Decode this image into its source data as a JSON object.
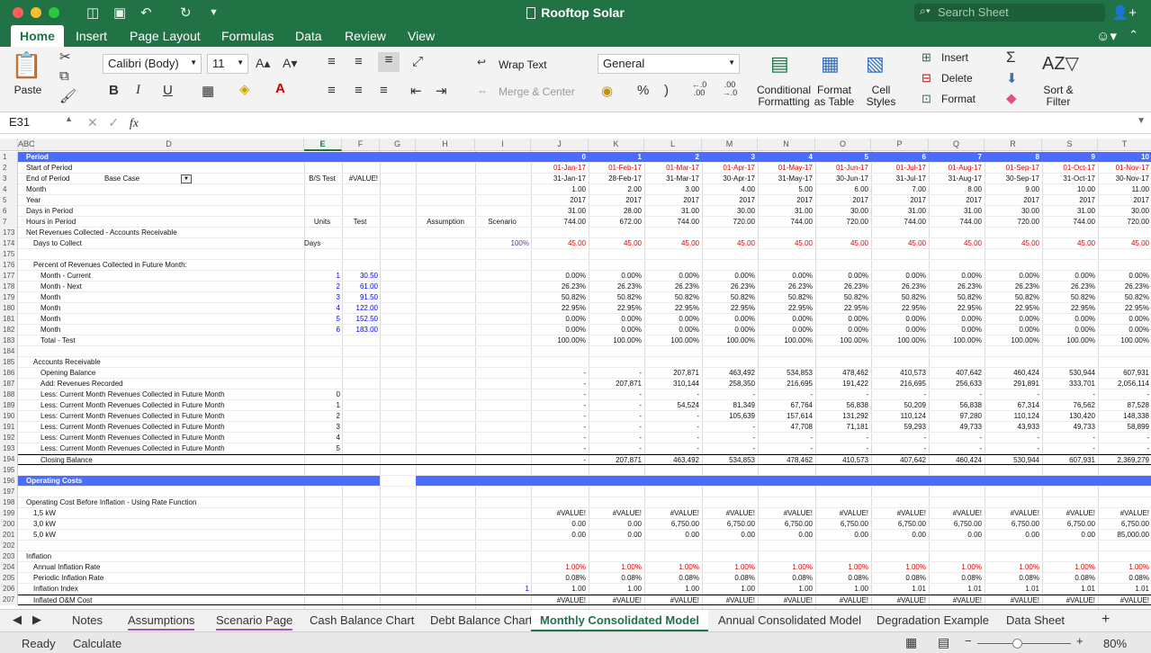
{
  "window": {
    "title": "Rooftop Solar",
    "search_placeholder": "Search Sheet"
  },
  "ribbon_tabs": [
    "Home",
    "Insert",
    "Page Layout",
    "Formulas",
    "Data",
    "Review",
    "View"
  ],
  "ribbon": {
    "paste": "Paste",
    "font_name": "Calibri (Body)",
    "font_size": "11",
    "wrap_text": "Wrap Text",
    "merge_center": "Merge & Center",
    "number_format": "General",
    "conditional_formatting": [
      "Conditional",
      "Formatting"
    ],
    "format_as_table": [
      "Format",
      "as Table"
    ],
    "cell_styles": [
      "Cell",
      "Styles"
    ],
    "insert": "Insert",
    "delete": "Delete",
    "format": "Format",
    "sort_filter": [
      "Sort &",
      "Filter"
    ],
    "bold": "B",
    "italic": "I",
    "underline": "U",
    "percent": "%",
    "comma": ")",
    "inc_dec": ".0\n.00",
    "dec_dec": ".00\n.0"
  },
  "formula_bar": {
    "name_box": "E31",
    "fx": "fx",
    "formula": ""
  },
  "columns": [
    "A",
    "B",
    "C",
    "D",
    "E",
    "F",
    "G",
    "H",
    "I",
    "J",
    "K",
    "L",
    "M",
    "N",
    "O",
    "P",
    "Q",
    "R",
    "S",
    "T"
  ],
  "selected_column": "E",
  "rows": [
    {
      "n": "1",
      "band": true,
      "label": "Period",
      "j": "0",
      "k": "1",
      "l": "2",
      "m": "3",
      "nn": "4",
      "o": "5",
      "p": "6",
      "q": "7",
      "r": "8",
      "s": "9",
      "t": "10"
    },
    {
      "n": "2",
      "label": "Start of Period",
      "red": true,
      "j": "01-Jan-17",
      "k": "01-Feb-17",
      "l": "01-Mar-17",
      "m": "01-Apr-17",
      "nn": "01-May-17",
      "o": "01-Jun-17",
      "p": "01-Jul-17",
      "q": "01-Aug-17",
      "r": "01-Sep-17",
      "s": "01-Oct-17",
      "t": "01-Nov-17"
    },
    {
      "n": "3",
      "label": "End of Period",
      "d2": "Base Case",
      "e": "B/S Test",
      "f": "#VALUE!",
      "j": "31-Jan-17",
      "k": "28-Feb-17",
      "l": "31-Mar-17",
      "m": "30-Apr-17",
      "nn": "31-May-17",
      "o": "30-Jun-17",
      "p": "31-Jul-17",
      "q": "31-Aug-17",
      "r": "30-Sep-17",
      "s": "31-Oct-17",
      "t": "30-Nov-17"
    },
    {
      "n": "4",
      "label": "Month",
      "j": "1.00",
      "k": "2.00",
      "l": "3.00",
      "m": "4.00",
      "nn": "5.00",
      "o": "6.00",
      "p": "7.00",
      "q": "8.00",
      "r": "9.00",
      "s": "10.00",
      "t": "11.00"
    },
    {
      "n": "5",
      "label": "Year",
      "j": "2017",
      "k": "2017",
      "l": "2017",
      "m": "2017",
      "nn": "2017",
      "o": "2017",
      "p": "2017",
      "q": "2017",
      "r": "2017",
      "s": "2017",
      "t": "2017"
    },
    {
      "n": "6",
      "label": "Days in Period",
      "j": "31.00",
      "k": "28.00",
      "l": "31.00",
      "m": "30.00",
      "nn": "31.00",
      "o": "30.00",
      "p": "31.00",
      "q": "31.00",
      "r": "30.00",
      "s": "31.00",
      "t": "30.00"
    },
    {
      "n": "7",
      "label": "Hours in Period",
      "e": "Units",
      "f": "Test",
      "h": "Assumption",
      "i": "Scenario",
      "j": "744.00",
      "k": "672.00",
      "l": "744.00",
      "m": "720.00",
      "nn": "744.00",
      "o": "720.00",
      "p": "744.00",
      "q": "744.00",
      "r": "720.00",
      "s": "744.00",
      "t": "720.00"
    },
    {
      "n": "173",
      "label": "Net Revenues Collected - Accounts Receivable"
    },
    {
      "n": "174",
      "label": "Days to Collect",
      "ind": 1,
      "e": "Days",
      "i": "100%",
      "ipurple": true,
      "red": true,
      "j": "45.00",
      "k": "45.00",
      "l": "45.00",
      "m": "45.00",
      "nn": "45.00",
      "o": "45.00",
      "p": "45.00",
      "q": "45.00",
      "r": "45.00",
      "s": "45.00",
      "t": "45.00"
    },
    {
      "n": "175"
    },
    {
      "n": "176",
      "label": "Percent of Revenues Collected in Future Month:",
      "ind": 1
    },
    {
      "n": "177",
      "label": "Month - Current",
      "ind": 2,
      "e": "1",
      "f": "30.50",
      "blue": true,
      "j": "0.00%",
      "k": "0.00%",
      "l": "0.00%",
      "m": "0.00%",
      "nn": "0.00%",
      "o": "0.00%",
      "p": "0.00%",
      "q": "0.00%",
      "r": "0.00%",
      "s": "0.00%",
      "t": "0.00%"
    },
    {
      "n": "178",
      "label": "Month - Next",
      "ind": 2,
      "e": "2",
      "f": "61.00",
      "blue": true,
      "j": "26.23%",
      "k": "26.23%",
      "l": "26.23%",
      "m": "26.23%",
      "nn": "26.23%",
      "o": "26.23%",
      "p": "26.23%",
      "q": "26.23%",
      "r": "26.23%",
      "s": "26.23%",
      "t": "26.23%"
    },
    {
      "n": "179",
      "label": "Month",
      "ind": 2,
      "e": "3",
      "f": "91.50",
      "blue": true,
      "j": "50.82%",
      "k": "50.82%",
      "l": "50.82%",
      "m": "50.82%",
      "nn": "50.82%",
      "o": "50.82%",
      "p": "50.82%",
      "q": "50.82%",
      "r": "50.82%",
      "s": "50.82%",
      "t": "50.82%"
    },
    {
      "n": "180",
      "label": "Month",
      "ind": 2,
      "e": "4",
      "f": "122.00",
      "blue": true,
      "j": "22.95%",
      "k": "22.95%",
      "l": "22.95%",
      "m": "22.95%",
      "nn": "22.95%",
      "o": "22.95%",
      "p": "22.95%",
      "q": "22.95%",
      "r": "22.95%",
      "s": "22.95%",
      "t": "22.95%"
    },
    {
      "n": "181",
      "label": "Month",
      "ind": 2,
      "e": "5",
      "f": "152.50",
      "blue": true,
      "j": "0.00%",
      "k": "0.00%",
      "l": "0.00%",
      "m": "0.00%",
      "nn": "0.00%",
      "o": "0.00%",
      "p": "0.00%",
      "q": "0.00%",
      "r": "0.00%",
      "s": "0.00%",
      "t": "0.00%"
    },
    {
      "n": "182",
      "label": "Month",
      "ind": 2,
      "e": "6",
      "f": "183.00",
      "blue": true,
      "j": "0.00%",
      "k": "0.00%",
      "l": "0.00%",
      "m": "0.00%",
      "nn": "0.00%",
      "o": "0.00%",
      "p": "0.00%",
      "q": "0.00%",
      "r": "0.00%",
      "s": "0.00%",
      "t": "0.00%"
    },
    {
      "n": "183",
      "label": "Total - Test",
      "ind": 2,
      "j": "100.00%",
      "k": "100.00%",
      "l": "100.00%",
      "m": "100.00%",
      "nn": "100.00%",
      "o": "100.00%",
      "p": "100.00%",
      "q": "100.00%",
      "r": "100.00%",
      "s": "100.00%",
      "t": "100.00%"
    },
    {
      "n": "184"
    },
    {
      "n": "185",
      "label": "Accounts Receivable",
      "ind": 1
    },
    {
      "n": "186",
      "label": "Opening Balance",
      "ind": 2,
      "j": "-",
      "k": "-",
      "l": "207,871",
      "m": "463,492",
      "nn": "534,853",
      "o": "478,462",
      "p": "410,573",
      "q": "407,642",
      "r": "460,424",
      "s": "530,944",
      "t": "607,931"
    },
    {
      "n": "187",
      "label": "Add: Revenues Recorded",
      "ind": 2,
      "j": "-",
      "k": "207,871",
      "l": "310,144",
      "m": "258,350",
      "nn": "216,695",
      "o": "191,422",
      "p": "216,695",
      "q": "256,633",
      "r": "291,891",
      "s": "333,701",
      "t": "2,056,114"
    },
    {
      "n": "188",
      "label": "Less: Current Month Revenues Collected in Future Month",
      "ind": 2,
      "e": "0",
      "j": "-",
      "k": "-",
      "l": "-",
      "m": "-",
      "nn": "-",
      "o": "-",
      "p": "-",
      "q": "-",
      "r": "-",
      "s": "-",
      "t": "-"
    },
    {
      "n": "189",
      "label": "Less: Current Month Revenues Collected in Future Month",
      "ind": 2,
      "e": "1",
      "j": "-",
      "k": "-",
      "l": "54,524",
      "m": "81,349",
      "nn": "67,764",
      "o": "56,838",
      "p": "50,209",
      "q": "56,838",
      "r": "67,314",
      "s": "76,562",
      "t": "87,528"
    },
    {
      "n": "190",
      "label": "Less: Current Month Revenues Collected in Future Month",
      "ind": 2,
      "e": "2",
      "j": "-",
      "k": "-",
      "l": "-",
      "m": "105,639",
      "nn": "157,614",
      "o": "131,292",
      "p": "110,124",
      "q": "97,280",
      "r": "110,124",
      "s": "130,420",
      "t": "148,338"
    },
    {
      "n": "191",
      "label": "Less: Current Month Revenues Collected in Future Month",
      "ind": 2,
      "e": "3",
      "j": "-",
      "k": "-",
      "l": "-",
      "m": "-",
      "nn": "47,708",
      "o": "71,181",
      "p": "59,293",
      "q": "49,733",
      "r": "43,933",
      "s": "49,733",
      "t": "58,899"
    },
    {
      "n": "192",
      "label": "Less: Current Month Revenues Collected in Future Month",
      "ind": 2,
      "e": "4",
      "j": "-",
      "k": "-",
      "l": "-",
      "m": "-",
      "nn": "-",
      "o": "-",
      "p": "-",
      "q": "-",
      "r": "-",
      "s": "-",
      "t": "-"
    },
    {
      "n": "193",
      "label": "Less: Current Month Revenues Collected in Future Month",
      "ind": 2,
      "e": "5",
      "j": "-",
      "k": "-",
      "l": "-",
      "m": "-",
      "nn": "-",
      "o": "-",
      "p": "-",
      "q": "-",
      "r": "-",
      "s": "-",
      "t": "-"
    },
    {
      "n": "194",
      "label": "Closing Balance",
      "ind": 2,
      "total": true,
      "j": "-",
      "k": "207,871",
      "l": "463,492",
      "m": "534,853",
      "nn": "478,462",
      "o": "410,573",
      "p": "407,642",
      "q": "460,424",
      "r": "530,944",
      "s": "607,931",
      "t": "2,369,279"
    },
    {
      "n": "195"
    },
    {
      "n": "196",
      "band2": true,
      "label": "Operating Costs"
    },
    {
      "n": "197"
    },
    {
      "n": "198",
      "label": "Operating Cost Before Inflation - Using Rate Function"
    },
    {
      "n": "199",
      "label": "1,5 kW",
      "ind": 1,
      "j": "#VALUE!",
      "k": "#VALUE!",
      "l": "#VALUE!",
      "m": "#VALUE!",
      "nn": "#VALUE!",
      "o": "#VALUE!",
      "p": "#VALUE!",
      "q": "#VALUE!",
      "r": "#VALUE!",
      "s": "#VALUE!",
      "t": "#VALUE!"
    },
    {
      "n": "200",
      "label": "3,0 kW",
      "ind": 1,
      "j": "0.00",
      "k": "0.00",
      "l": "6,750.00",
      "m": "6,750.00",
      "nn": "6,750.00",
      "o": "6,750.00",
      "p": "6,750.00",
      "q": "6,750.00",
      "r": "6,750.00",
      "s": "6,750.00",
      "t": "6,750.00"
    },
    {
      "n": "201",
      "label": "5,0 kW",
      "ind": 1,
      "j": "0.00",
      "k": "0.00",
      "l": "0.00",
      "m": "0.00",
      "nn": "0.00",
      "o": "0.00",
      "p": "0.00",
      "q": "0.00",
      "r": "0.00",
      "s": "0.00",
      "t": "85,000.00"
    },
    {
      "n": "202"
    },
    {
      "n": "203",
      "label": "Inflation"
    },
    {
      "n": "204",
      "label": "Annual Inflation Rate",
      "ind": 1,
      "red": true,
      "j": "1.00%",
      "k": "1.00%",
      "l": "1.00%",
      "m": "1.00%",
      "nn": "1.00%",
      "o": "1.00%",
      "p": "1.00%",
      "q": "1.00%",
      "r": "1.00%",
      "s": "1.00%",
      "t": "1.00%"
    },
    {
      "n": "205",
      "label": "Periodic Inflation Rate",
      "ind": 1,
      "j": "0.08%",
      "k": "0.08%",
      "l": "0.08%",
      "m": "0.08%",
      "nn": "0.08%",
      "o": "0.08%",
      "p": "0.08%",
      "q": "0.08%",
      "r": "0.08%",
      "s": "0.08%",
      "t": "0.08%"
    },
    {
      "n": "206",
      "label": "Inflation Index",
      "ind": 1,
      "i": "1",
      "iblue": true,
      "j": "1.00",
      "k": "1.00",
      "l": "1.00",
      "m": "1.00",
      "nn": "1.00",
      "o": "1.00",
      "p": "1.01",
      "q": "1.01",
      "r": "1.01",
      "s": "1.01",
      "t": "1.01"
    },
    {
      "n": "207",
      "label": "Inflated O&M Cost",
      "ind": 1,
      "total": true,
      "j": "#VALUE!",
      "k": "#VALUE!",
      "l": "#VALUE!",
      "m": "#VALUE!",
      "nn": "#VALUE!",
      "o": "#VALUE!",
      "p": "#VALUE!",
      "q": "#VALUE!",
      "r": "#VALUE!",
      "s": "#VALUE!",
      "t": "#VALUE!"
    }
  ],
  "sheet_tabs": [
    "Notes",
    "Assumptions",
    "Scenario Page",
    "Cash Balance Chart",
    "Debt Balance Chart",
    "Monthly Consolidated Model",
    "Annual Consolidated Model",
    "Degradation Example",
    "Data Sheet"
  ],
  "active_sheet": "Monthly Consolidated Model",
  "status": {
    "ready": "Ready",
    "calculate": "Calculate",
    "zoom": "80%"
  },
  "colors": {
    "excel_green": "#217346",
    "band_blue": "#4a6dff"
  }
}
